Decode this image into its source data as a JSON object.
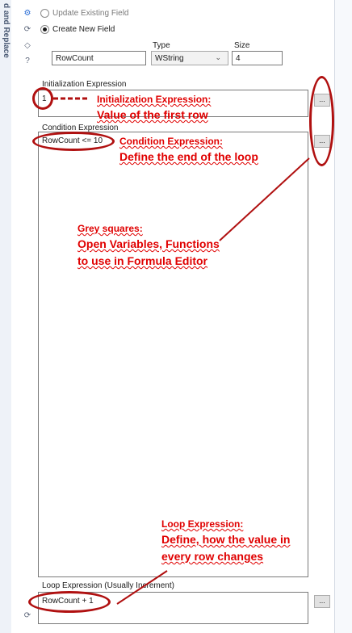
{
  "sidebar": {
    "title": "d and Replace"
  },
  "toolbar_icons": [
    "gear-icon",
    "refresh-icon",
    "tag-icon",
    "help-icon"
  ],
  "form": {
    "update_existing_label": "Update Existing Field",
    "create_new_label": "Create New  Field",
    "type_label": "Type",
    "size_label": "Size",
    "field_name_value": "RowCount",
    "type_value": "WString",
    "size_value": "4",
    "init_label": "Initialization Expression",
    "init_value": "1",
    "condition_label": "Condition Expression",
    "condition_value": "RowCount <= 10",
    "loop_label": "Loop Expression (Usually Increment)",
    "loop_value": "RowCount + 1",
    "ellipsis": "..."
  },
  "annotations": {
    "init_title": "Initialization Expression:",
    "init_body": "Value of the first row",
    "cond_title": "Condition Expression:",
    "cond_body": "Define the end of the loop",
    "grey_title": "Grey squares:",
    "grey_body_1": "Open Variables, Functions",
    "grey_body_2": "to use in Formula Editor",
    "loop_title": "Loop Expression:",
    "loop_body_1": "Define, how the value in",
    "loop_body_2": "every row changes"
  },
  "colors": {
    "annotation": "#e00000",
    "oval": "#b01010",
    "sidebar": "#eef2f8"
  }
}
